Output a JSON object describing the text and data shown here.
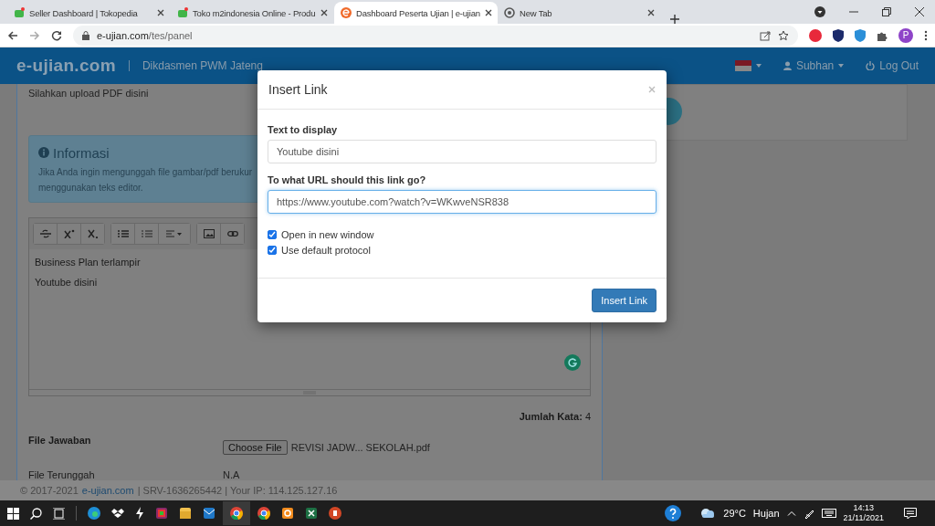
{
  "browser": {
    "tabs": [
      {
        "title": "Seller Dashboard | Tokopedia",
        "selected": false
      },
      {
        "title": "Toko m2indonesia Online - Produ",
        "selected": false
      },
      {
        "title": "Dashboard Peserta Ujian | e-ujian",
        "selected": true
      },
      {
        "title": "New Tab",
        "selected": false
      }
    ],
    "url_host": "e-ujian.com",
    "url_path": "/tes/panel",
    "profile_initial": "P"
  },
  "navbar": {
    "brand": "e-ujian.com",
    "org": "Dikdasmen PWM Jateng",
    "user": "Subhan",
    "logout": "Log Out"
  },
  "page": {
    "instruction": "Silahkan upload PDF disini",
    "info": {
      "title": "Informasi",
      "lines": [
        "Jika Anda ingin mengunggah file gambar/pdf berukur",
        "menggunakan teks editor."
      ]
    },
    "editor": {
      "lines": [
        "Business Plan terlampir",
        "Youtube disini"
      ]
    },
    "word_count": {
      "label": "Jumlah Kata:",
      "value": "4"
    },
    "answer_file": {
      "label": "File Jawaban",
      "button": "Choose File",
      "file_name": "REVISI JADW... SEKOLAH.pdf"
    },
    "uploaded_file": {
      "label": "File Terunggah",
      "value": "N.A"
    }
  },
  "footer": {
    "copyright": "© 2017-2021",
    "link": "e-ujian.com",
    "details": "| SRV-1636265442 | Your IP: 114.125.127.16"
  },
  "modal": {
    "title": "Insert Link",
    "fields": [
      {
        "label": "Text to display",
        "value": "Youtube disini",
        "focused": false
      },
      {
        "label": "To what URL should this link go?",
        "value": "https://www.youtube.com?watch?v=WKwveNSR838",
        "focused": true
      }
    ],
    "checkboxes": [
      {
        "label": "Open in new window",
        "checked": true
      },
      {
        "label": "Use default protocol",
        "checked": true
      }
    ],
    "button": "Insert Link"
  },
  "taskbar": {
    "temperature": "29°C",
    "weather": "Hujan",
    "time": "14:13",
    "date": "21/11/2021"
  }
}
